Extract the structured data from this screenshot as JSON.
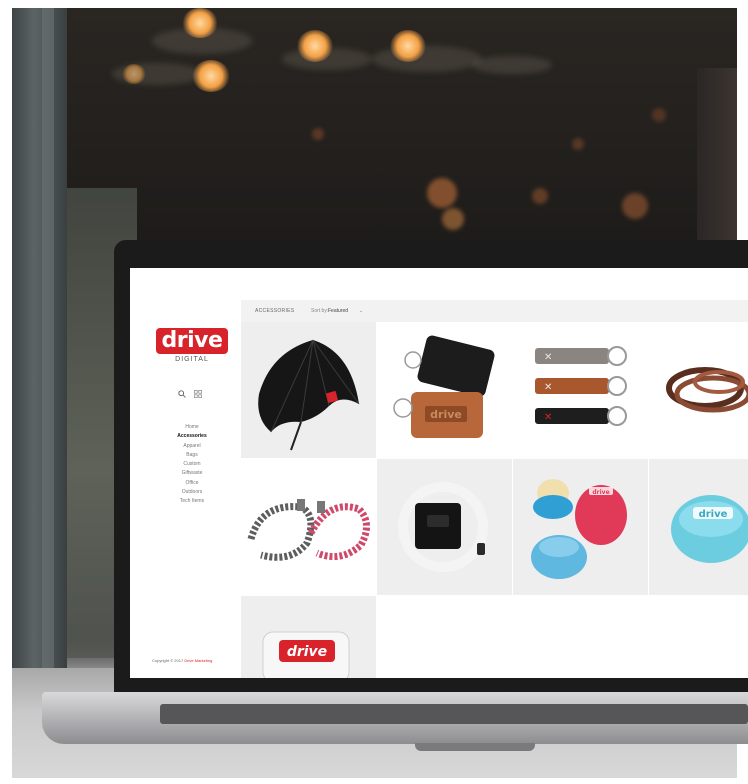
{
  "site": {
    "logo_text": "drive",
    "logo_sub": "DIGITAL",
    "brand_color": "#d8232a",
    "nav_items": [
      {
        "label": "Home",
        "active": false
      },
      {
        "label": "Accessories",
        "active": true
      },
      {
        "label": "Apparel",
        "active": false
      },
      {
        "label": "Bags",
        "active": false
      },
      {
        "label": "Custom",
        "active": false
      },
      {
        "label": "Giftwaste",
        "active": false
      },
      {
        "label": "Office",
        "active": false
      },
      {
        "label": "Outdoors",
        "active": false
      },
      {
        "label": "Tech Items",
        "active": false
      }
    ],
    "copyright_prefix": "Copyright © 2017 ",
    "copyright_brand": "Drive Marketing",
    "sidebar_icons": [
      "search-icon",
      "grid-view-icon"
    ]
  },
  "toolbar": {
    "breadcrumb": "ACCESSORIES",
    "sort_label": "Sort by:",
    "sort_value": "Featured",
    "sort_chevron": "⌄"
  },
  "products": {
    "umbrella": {
      "name": "umbrella"
    },
    "luggage_tags": {
      "name": "luggage tags",
      "brand": "drive"
    },
    "keychains": {
      "name": "keychains"
    },
    "bracelets": {
      "name": "leather bracelets"
    },
    "lanyards": {
      "name": "lanyards"
    },
    "tape_measure": {
      "name": "tape measure"
    },
    "lip_balms": {
      "name": "lip balms",
      "brand": "drive"
    },
    "lip_balm_teal": {
      "name": "lip balm teal",
      "brand": "drive"
    },
    "mint_tin": {
      "name": "mint tin",
      "brand": "drive"
    }
  }
}
